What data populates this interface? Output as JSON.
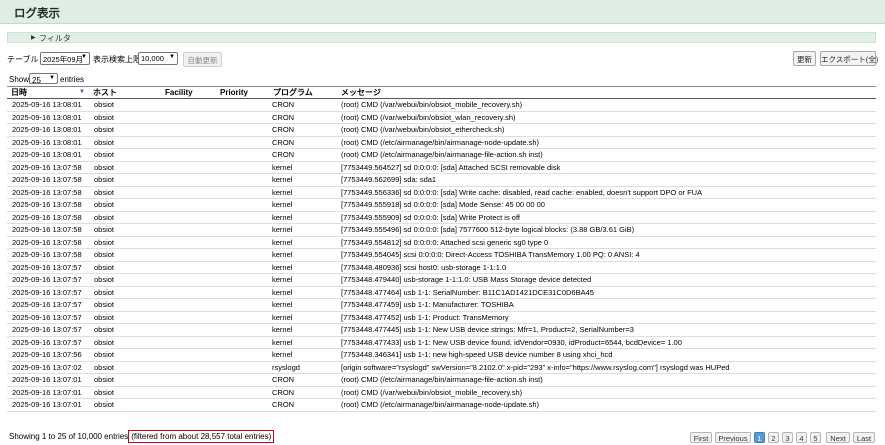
{
  "header": {
    "title": "ログ表示"
  },
  "filter": {
    "label": "フィルタ"
  },
  "toolbar": {
    "table_label": "テーブル",
    "table_value": "2025年09月",
    "limit_label": "表示検索上限",
    "limit_value": "10,000",
    "auto_refresh": "自動更新",
    "refresh": "更新",
    "export": "エクスポート(全)"
  },
  "length": {
    "show": "Show",
    "value": "25",
    "entries": "entries"
  },
  "columns": [
    "日時",
    "ホスト",
    "Facility",
    "Priority",
    "プログラム",
    "メッセージ"
  ],
  "rows": [
    [
      "2025-09-16 13:08:01",
      "obsiot",
      "",
      "",
      "CRON",
      "(root) CMD (/var/webui/bin/obsiot_mobile_recovery.sh)"
    ],
    [
      "2025-09-16 13:08:01",
      "obsiot",
      "",
      "",
      "CRON",
      "(root) CMD (/var/webui/bin/obsiot_wlan_recovery.sh)"
    ],
    [
      "2025-09-16 13:08:01",
      "obsiot",
      "",
      "",
      "CRON",
      "(root) CMD (/var/webui/bin/obsiot_ethercheck.sh)"
    ],
    [
      "2025-09-16 13:08:01",
      "obsiot",
      "",
      "",
      "CRON",
      "(root) CMD (/etc/airmanage/bin/airmanage-node-update.sh)"
    ],
    [
      "2025-09-16 13:08:01",
      "obsiot",
      "",
      "",
      "CRON",
      "(root) CMD (/etc/airmanage/bin/airmanage-file-action.sh inst)"
    ],
    [
      "2025-09-16 13:07:58",
      "obsiot",
      "",
      "",
      "kernel",
      "[7753449.564527] sd 0:0:0:0: [sda] Attached SCSI removable disk"
    ],
    [
      "2025-09-16 13:07:58",
      "obsiot",
      "",
      "",
      "kernel",
      "[7753449.562699] sda: sda1"
    ],
    [
      "2025-09-16 13:07:58",
      "obsiot",
      "",
      "",
      "kernel",
      "[7753449.556336] sd 0:0:0:0: [sda] Write cache: disabled, read cache: enabled, doesn't support DPO or FUA"
    ],
    [
      "2025-09-16 13:07:58",
      "obsiot",
      "",
      "",
      "kernel",
      "[7753449.555918] sd 0:0:0:0: [sda] Mode Sense: 45 00 00 00"
    ],
    [
      "2025-09-16 13:07:58",
      "obsiot",
      "",
      "",
      "kernel",
      "[7753449.555909] sd 0:0:0:0: [sda] Write Protect is off"
    ],
    [
      "2025-09-16 13:07:58",
      "obsiot",
      "",
      "",
      "kernel",
      "[7753449.555496] sd 0:0:0:0: [sda] 7577600 512-byte logical blocks: (3.88 GB/3.61 GiB)"
    ],
    [
      "2025-09-16 13:07:58",
      "obsiot",
      "",
      "",
      "kernel",
      "[7753449.554812] sd 0:0:0:0: Attached scsi generic sg0 type 0"
    ],
    [
      "2025-09-16 13:07:58",
      "obsiot",
      "",
      "",
      "kernel",
      "[7753449.554045] scsi 0:0:0:0: Direct-Access TOSHIBA TransMemory 1.00 PQ: 0 ANSI: 4"
    ],
    [
      "2025-09-16 13:07:57",
      "obsiot",
      "",
      "",
      "kernel",
      "[7753448.480936] scsi host0: usb-storage 1-1:1.0"
    ],
    [
      "2025-09-16 13:07:57",
      "obsiot",
      "",
      "",
      "kernel",
      "[7753448.479440] usb-storage 1-1:1.0: USB Mass Storage device detected"
    ],
    [
      "2025-09-16 13:07:57",
      "obsiot",
      "",
      "",
      "kernel",
      "[7753448.477464] usb 1-1: SerialNumber: B11C1AD1421DCE31C0D6BA45"
    ],
    [
      "2025-09-16 13:07:57",
      "obsiot",
      "",
      "",
      "kernel",
      "[7753448.477459] usb 1-1: Manufacturer: TOSHIBA"
    ],
    [
      "2025-09-16 13:07:57",
      "obsiot",
      "",
      "",
      "kernel",
      "[7753448.477452] usb 1-1: Product: TransMemory"
    ],
    [
      "2025-09-16 13:07:57",
      "obsiot",
      "",
      "",
      "kernel",
      "[7753448.477445] usb 1-1: New USB device strings: Mfr=1, Product=2, SerialNumber=3"
    ],
    [
      "2025-09-16 13:07:57",
      "obsiot",
      "",
      "",
      "kernel",
      "[7753448.477433] usb 1-1: New USB device found, idVendor=0930, idProduct=6544, bcdDevice= 1.00"
    ],
    [
      "2025-09-16 13:07:56",
      "obsiot",
      "",
      "",
      "kernel",
      "[7753448.346341] usb 1-1: new high-speed USB device number 8 using xhci_hcd"
    ],
    [
      "2025-09-16 13:07:02",
      "obsiot",
      "",
      "",
      "rsyslogd",
      "[origin software=\"rsyslogd\" swVersion=\"8.2102.0\" x-pid=\"293\" x-info=\"https://www.rsyslog.com\"] rsyslogd was HUPed"
    ],
    [
      "2025-09-16 13:07:01",
      "obsiot",
      "",
      "",
      "CRON",
      "(root) CMD (/etc/airmanage/bin/airmanage-file-action.sh inst)"
    ],
    [
      "2025-09-16 13:07:01",
      "obsiot",
      "",
      "",
      "CRON",
      "(root) CMD (/var/webui/bin/obsiot_mobile_recovery.sh)"
    ],
    [
      "2025-09-16 13:07:01",
      "obsiot",
      "",
      "",
      "CRON",
      "(root) CMD (/etc/airmanage/bin/airmanage-node-update.sh)"
    ]
  ],
  "info": {
    "showing": "Showing 1 to 25 of 10,000 entries",
    "filtered": "(filtered from about 28,557 total entries)"
  },
  "pagination": {
    "first": "First",
    "previous": "Previous",
    "pages": [
      "1",
      "2",
      "3",
      "4",
      "5"
    ],
    "next": "Next",
    "last": "Last"
  }
}
